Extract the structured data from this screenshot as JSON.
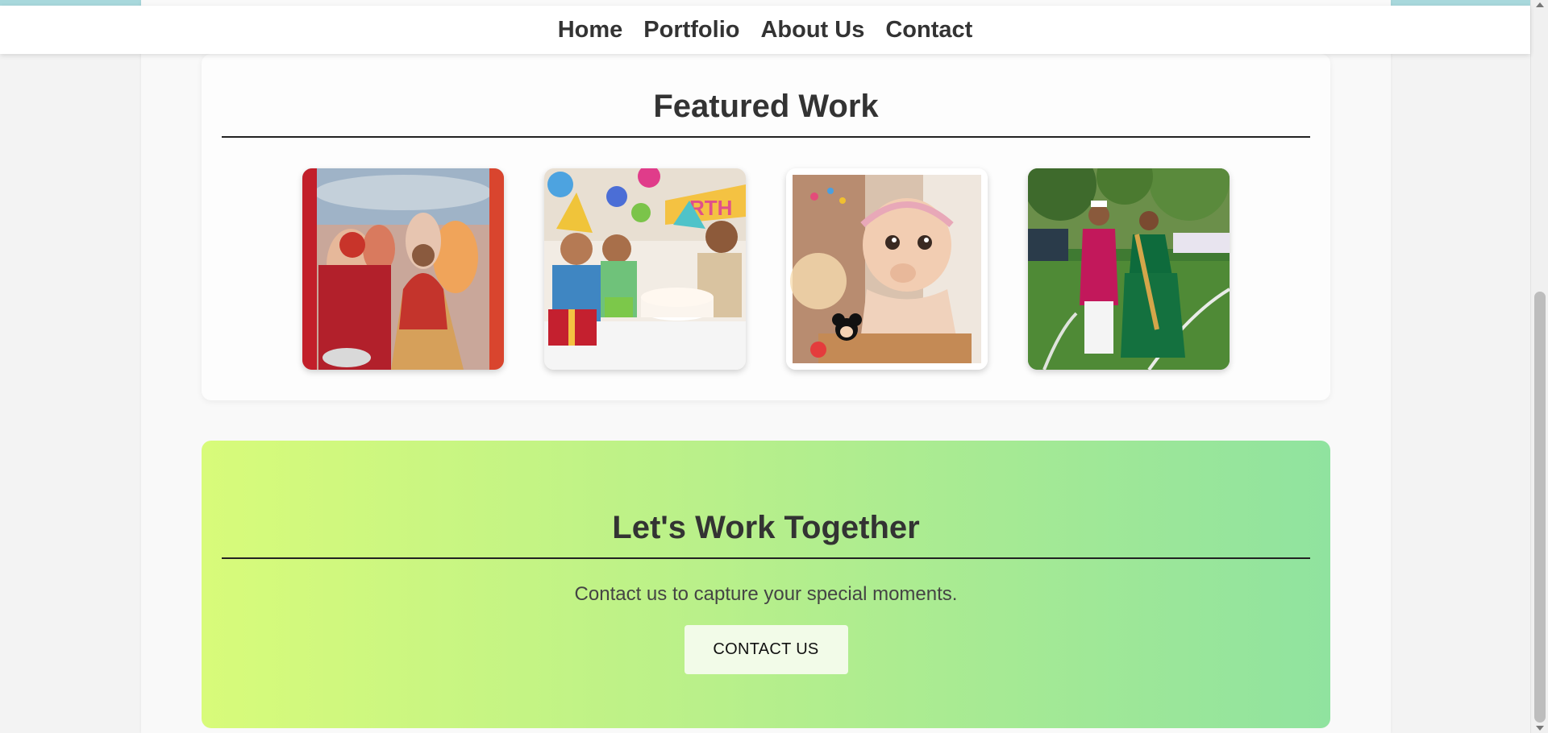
{
  "nav": {
    "items": [
      {
        "label": "Home"
      },
      {
        "label": "Portfolio"
      },
      {
        "label": "About Us"
      },
      {
        "label": "Contact"
      }
    ]
  },
  "featured": {
    "title": "Featured Work",
    "images": [
      {
        "name": "wedding-celebration-photo"
      },
      {
        "name": "birthday-party-photo"
      },
      {
        "name": "baby-portrait-photo"
      },
      {
        "name": "couple-outdoor-photo"
      }
    ]
  },
  "cta": {
    "title": "Let's Work Together",
    "text": "Contact us to capture your special moments.",
    "button_label": "CONTACT US",
    "gradient_start": "#d8fb7a",
    "gradient_end": "#90e39f"
  },
  "colors": {
    "text": "#333333",
    "topstrip": "#a8d8dc",
    "background": "#f3f3f3"
  }
}
